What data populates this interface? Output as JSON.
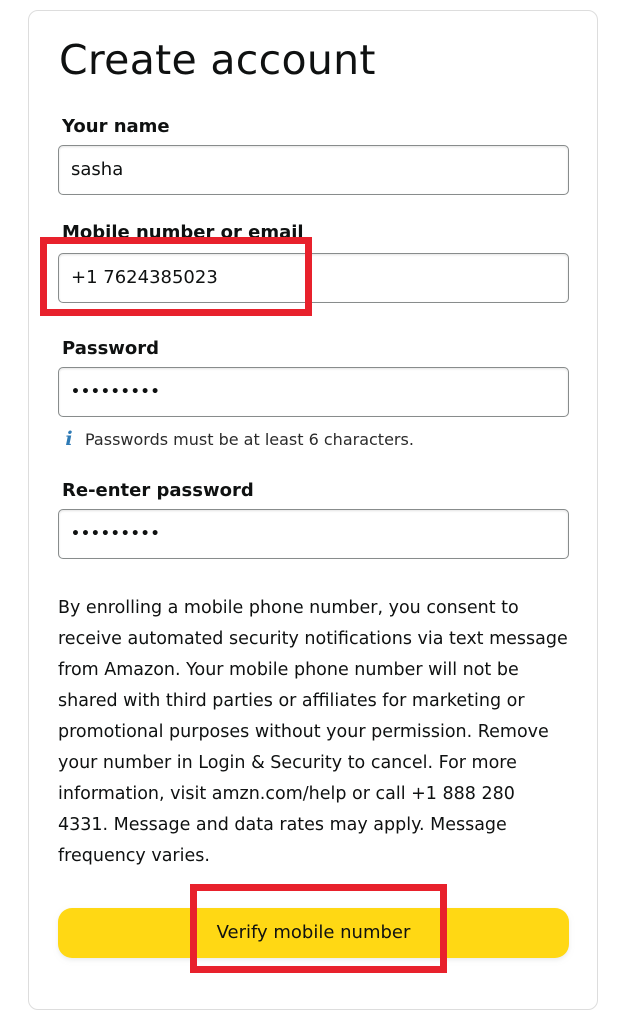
{
  "form": {
    "title": "Create account",
    "name": {
      "label": "Your name",
      "value": "sasha"
    },
    "mobile": {
      "label": "Mobile number or email",
      "value": "+1 7624385023"
    },
    "password": {
      "label": "Password",
      "value": "•••••••••"
    },
    "password_hint": "Passwords must be at least 6 characters.",
    "reenter_password": {
      "label": "Re-enter password",
      "value": "•••••••••"
    },
    "consent_text": "By enrolling a mobile phone number, you consent to receive automated security notifications via text message from Amazon. Your mobile phone number will not be shared with third parties or affiliates for marketing or promotional purposes without your permission. Remove your number in Login & Security to cancel. For more information, visit amzn.com/help or call +1 888 280 4331. Message and data rates may apply. Message frequency varies.",
    "verify_button_label": "Verify mobile number"
  },
  "icons": {
    "hint_icon": "info-icon"
  },
  "colors": {
    "button_background": "#ffd814",
    "annotation_border": "#e8212c",
    "info_icon": "#2e7ab5",
    "input_border": "#888c8c"
  }
}
